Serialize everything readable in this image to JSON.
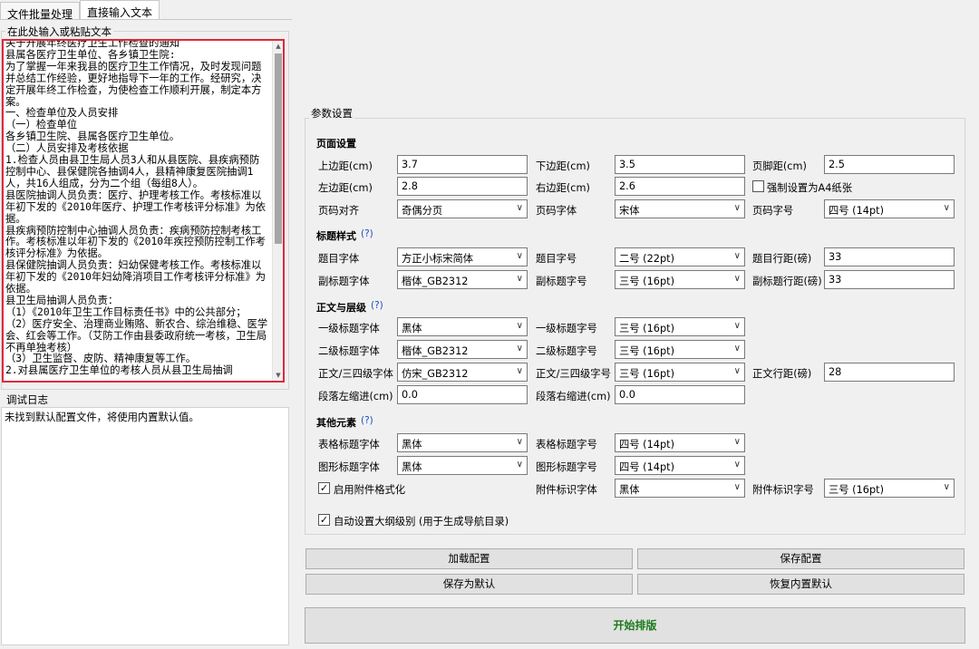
{
  "tabs": [
    {
      "label": "文件批量处理"
    },
    {
      "label": "直接输入文本"
    }
  ],
  "input_group": {
    "label": "在此处输入或粘贴文本"
  },
  "editor": {
    "text": "关于开展年终医疗卫生工作检查的通知\n县属各医疗卫生单位、各乡镇卫生院:\n为了掌握一年来我县的医疗卫生工作情况，及时发现问题并总结工作经验，更好地指导下一年的工作。经研究，决定开展年终工作检查，为使检查工作顺利开展，制定本方案。\n一、检查单位及人员安排\n（一）检查单位\n各乡镇卫生院、县属各医疗卫生单位。\n（二）人员安排及考核依据\n1.检查人员由县卫生局人员3人和从县医院、县疾病预防控制中心、县保健院各抽调4人，县精神康复医院抽调1人，共16人组成，分为二个组（每组8人）。\n县医院抽调人员负责：医疗、护理考核工作。考核标准以年初下发的《2010年医疗、护理工作考核评分标准》为依据。\n县疾病预防控制中心抽调人员负责：疾病预防控制考核工作。考核标准以年初下发的《2010年疾控预防控制工作考核评分标准》为依据。\n县保健院抽调人员负责：妇幼保健考核工作。考核标准以年初下发的《2010年妇幼降消项目工作考核评分标准》为依据。\n县卫生局抽调人员负责：\n（1）《2010年卫生工作目标责任书》中的公共部分；\n（2）医疗安全、治理商业贿赂、新农合、综治维稳、医学会、红会等工作。（艾防工作由县委政府统一考核，卫生局不再单独考核）\n（3）卫生监督、皮防、精神康复等工作。\n2.对县属医疗卫生单位的考核人员从县卫生局抽调"
  },
  "log": {
    "label": "调试日志",
    "text": "未找到默认配置文件，将使用内置默认值。"
  },
  "params": {
    "title": "参数设置",
    "page_setup": {
      "title": "页面设置",
      "top_margin_label": "上边距(cm)",
      "top_margin": "3.7",
      "bottom_margin_label": "下边距(cm)",
      "bottom_margin": "3.5",
      "footer_margin_label": "页脚距(cm)",
      "footer_margin": "2.5",
      "left_margin_label": "左边距(cm)",
      "left_margin": "2.8",
      "right_margin_label": "右边距(cm)",
      "right_margin": "2.6",
      "force_a4_label": "强制设置为A4纸张",
      "page_num_align_label": "页码对齐",
      "page_num_align": "奇偶分页",
      "page_num_font_label": "页码字体",
      "page_num_font": "宋体",
      "page_num_size_label": "页码字号",
      "page_num_size": "四号 (14pt)"
    },
    "title_style": {
      "title": "标题样式",
      "help": "(?)",
      "title_font_label": "题目字体",
      "title_font": "方正小标宋简体",
      "title_size_label": "题目字号",
      "title_size": "二号 (22pt)",
      "title_spacing_label": "题目行距(磅)",
      "title_spacing": "33",
      "subtitle_font_label": "副标题字体",
      "subtitle_font": "楷体_GB2312",
      "subtitle_size_label": "副标题字号",
      "subtitle_size": "三号 (16pt)",
      "subtitle_spacing_label": "副标题行距(磅)",
      "subtitle_spacing": "33"
    },
    "body": {
      "title": "正文与层级",
      "help": "(?)",
      "h1_font_label": "一级标题字体",
      "h1_font": "黑体",
      "h1_size_label": "一级标题字号",
      "h1_size": "三号 (16pt)",
      "h2_font_label": "二级标题字体",
      "h2_font": "楷体_GB2312",
      "h2_size_label": "二级标题字号",
      "h2_size": "三号 (16pt)",
      "body_font_label": "正文/三四级字体",
      "body_font": "仿宋_GB2312",
      "body_size_label": "正文/三四级字号",
      "body_size": "三号 (16pt)",
      "body_spacing_label": "正文行距(磅)",
      "body_spacing": "28",
      "left_indent_label": "段落左缩进(cm)",
      "left_indent": "0.0",
      "right_indent_label": "段落右缩进(cm)",
      "right_indent": "0.0"
    },
    "other": {
      "title": "其他元素",
      "help": "(?)",
      "table_font_label": "表格标题字体",
      "table_font": "黑体",
      "table_size_label": "表格标题字号",
      "table_size": "四号 (14pt)",
      "figure_font_label": "图形标题字体",
      "figure_font": "黑体",
      "figure_size_label": "图形标题字号",
      "figure_size": "四号 (14pt)",
      "attach_enable_label": "启用附件格式化",
      "attach_font_label": "附件标识字体",
      "attach_font": "黑体",
      "attach_size_label": "附件标识字号",
      "attach_size": "三号 (16pt)"
    },
    "auto_outline_label": "自动设置大纲级别 (用于生成导航目录)"
  },
  "buttons": {
    "load": "加载配置",
    "save": "保存配置",
    "save_default": "保存为默认",
    "restore": "恢复内置默认",
    "start": "开始排版"
  }
}
